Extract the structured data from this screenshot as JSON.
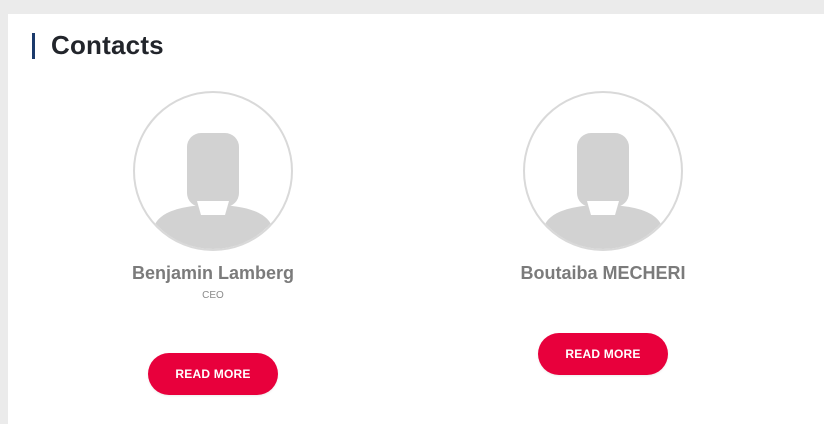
{
  "section": {
    "title": "Contacts"
  },
  "contacts": [
    {
      "name": "Benjamin Lamberg",
      "role": "CEO",
      "button_label": "READ MORE",
      "avatar_icon": "default-user-avatar-icon"
    },
    {
      "name": "Boutaiba MECHERI",
      "role": "",
      "button_label": "READ MORE",
      "avatar_icon": "default-user-avatar-icon"
    }
  ],
  "colors": {
    "accent_bar": "#1b3a6b",
    "button": "#e8003c",
    "name_text": "#7b7b7b",
    "avatar_silhouette": "#d2d2d2"
  }
}
